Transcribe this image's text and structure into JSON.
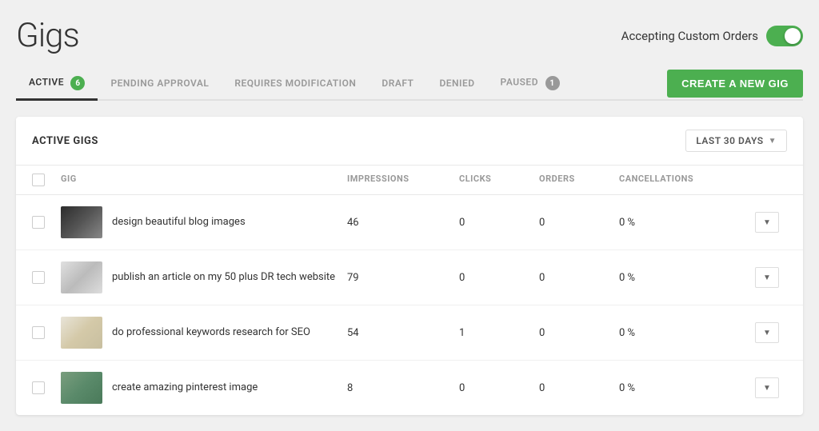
{
  "header": {
    "page_title": "Gigs",
    "accepting_label": "Accepting Custom Orders",
    "toggle_on": true
  },
  "tabs": [
    {
      "id": "active",
      "label": "ACTIVE",
      "badge": "6",
      "badge_color": "green",
      "active": true
    },
    {
      "id": "pending",
      "label": "PENDING APPROVAL",
      "badge": null,
      "active": false
    },
    {
      "id": "requires",
      "label": "REQUIRES MODIFICATION",
      "badge": null,
      "active": false
    },
    {
      "id": "draft",
      "label": "DRAFT",
      "badge": null,
      "active": false
    },
    {
      "id": "denied",
      "label": "DENIED",
      "badge": null,
      "active": false
    },
    {
      "id": "paused",
      "label": "PAUSED",
      "badge": "1",
      "badge_color": "grey",
      "active": false
    }
  ],
  "create_button": "CREATE A NEW GIG",
  "table": {
    "section_title": "ACTIVE GIGS",
    "date_filter": "LAST 30 DAYS",
    "columns": [
      "GIG",
      "IMPRESSIONS",
      "CLICKS",
      "ORDERS",
      "CANCELLATIONS"
    ],
    "rows": [
      {
        "id": 1,
        "name": "design beautiful blog images",
        "impressions": "46",
        "clicks": "0",
        "orders": "0",
        "cancellations": "0 %",
        "thumb_class": "thumb-1"
      },
      {
        "id": 2,
        "name": "publish an article on my 50 plus DR tech website",
        "impressions": "79",
        "clicks": "0",
        "orders": "0",
        "cancellations": "0 %",
        "thumb_class": "thumb-2"
      },
      {
        "id": 3,
        "name": "do professional keywords research for SEO",
        "impressions": "54",
        "clicks": "1",
        "orders": "0",
        "cancellations": "0 %",
        "thumb_class": "thumb-3"
      },
      {
        "id": 4,
        "name": "create amazing pinterest image",
        "impressions": "8",
        "clicks": "0",
        "orders": "0",
        "cancellations": "0 %",
        "thumb_class": "thumb-4"
      }
    ]
  }
}
